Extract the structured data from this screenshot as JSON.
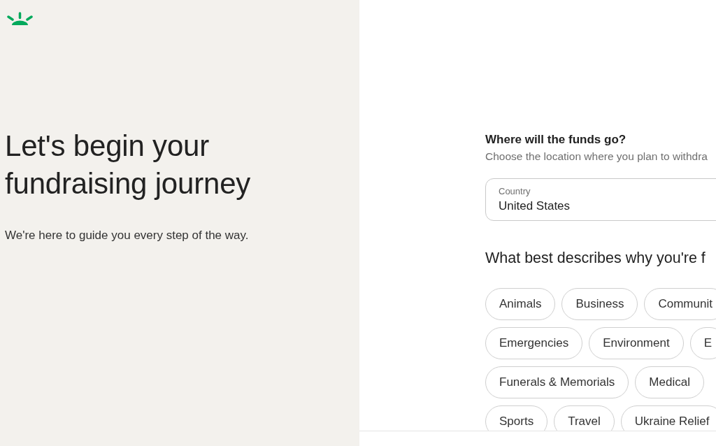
{
  "intro": {
    "title": "Let's begin your fundraising journey",
    "subtitle": "We're here to guide you every step of the way."
  },
  "funds": {
    "title": "Where will the funds go?",
    "subtitle": "Choose the location where you plan to withdra",
    "country_field": {
      "label": "Country",
      "value": "United States"
    }
  },
  "categories": {
    "title": "What best describes why you're f",
    "rows": [
      [
        {
          "label": "Animals",
          "selected": false
        },
        {
          "label": "Business",
          "selected": false
        },
        {
          "label": "Communit",
          "selected": false
        }
      ],
      [
        {
          "label": "Emergencies",
          "selected": false
        },
        {
          "label": "Environment",
          "selected": false
        },
        {
          "label": "E",
          "selected": false
        }
      ],
      [
        {
          "label": "Funerals & Memorials",
          "selected": false
        },
        {
          "label": "Medical",
          "selected": false
        }
      ],
      [
        {
          "label": "Sports",
          "selected": false
        },
        {
          "label": "Travel",
          "selected": false
        },
        {
          "label": "Ukraine Relief",
          "selected": false
        }
      ]
    ]
  }
}
